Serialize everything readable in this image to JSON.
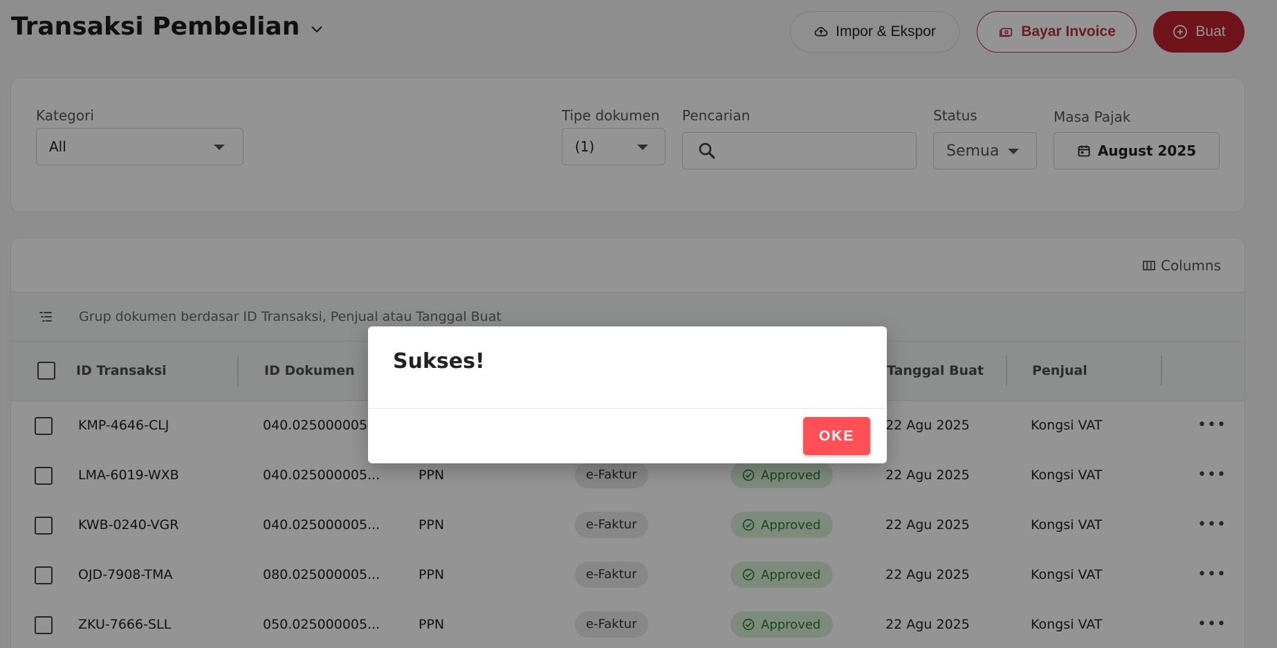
{
  "header": {
    "title": "Transaksi Pembelian",
    "import_export_label": "Impor & Ekspor",
    "pay_invoice_label": "Bayar Invoice",
    "create_label": "Buat"
  },
  "filters": {
    "category": {
      "label": "Kategori",
      "value": "All"
    },
    "doc_type": {
      "label": "Tipe dokumen",
      "value": "(1)"
    },
    "search": {
      "label": "Pencarian",
      "placeholder": ""
    },
    "status": {
      "label": "Status",
      "value": "Semua"
    },
    "tax_period": {
      "label": "Masa Pajak",
      "value": "August 2025"
    }
  },
  "table": {
    "columns_label": "Columns",
    "group_hint": "Grup dokumen berdasar ID Transaksi, Penjual atau Tanggal Buat",
    "headers": {
      "transaction_id": "ID Transaksi",
      "document_id": "ID Dokumen",
      "created_date": "Tanggal Buat",
      "seller": "Penjual"
    },
    "rows": [
      {
        "transaction_id": "KMP-4646-CLJ",
        "document_id": "040.025000005...",
        "tax": "",
        "doc_kind": "",
        "status": "",
        "created_date": "22 Agu 2025",
        "seller": "Kongsi VAT"
      },
      {
        "transaction_id": "LMA-6019-WXB",
        "document_id": "040.025000005...",
        "tax": "PPN",
        "doc_kind": "e-Faktur",
        "status": "Approved",
        "created_date": "22 Agu 2025",
        "seller": "Kongsi VAT"
      },
      {
        "transaction_id": "KWB-0240-VGR",
        "document_id": "040.025000005...",
        "tax": "PPN",
        "doc_kind": "e-Faktur",
        "status": "Approved",
        "created_date": "22 Agu 2025",
        "seller": "Kongsi VAT"
      },
      {
        "transaction_id": "OJD-7908-TMA",
        "document_id": "080.025000005...",
        "tax": "PPN",
        "doc_kind": "e-Faktur",
        "status": "Approved",
        "created_date": "22 Agu 2025",
        "seller": "Kongsi VAT"
      },
      {
        "transaction_id": "ZKU-7666-SLL",
        "document_id": "050.025000005...",
        "tax": "PPN",
        "doc_kind": "e-Faktur",
        "status": "Approved",
        "created_date": "22 Agu 2025",
        "seller": "Kongsi VAT"
      }
    ]
  },
  "modal": {
    "title": "Sukses!",
    "ok_label": "OKE"
  },
  "colors": {
    "brand": "#c0242e",
    "ok_button": "#ff4f57",
    "approved_bg": "#d8efd7",
    "approved_text": "#2c7a2e"
  }
}
